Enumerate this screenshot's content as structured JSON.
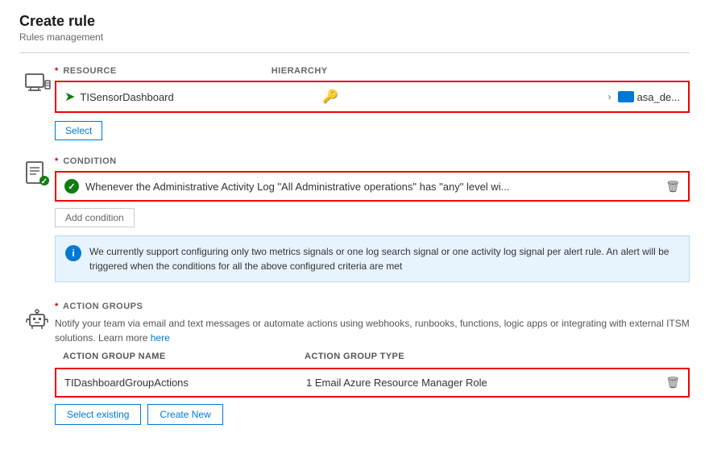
{
  "page": {
    "title": "Create rule",
    "subtitle": "Rules management"
  },
  "resource_section": {
    "label": "RESOURCE",
    "hierarchy_label": "HIERARCHY",
    "resource_name": "TISensorDashboard",
    "hierarchy_asa": "asa_de...",
    "select_button": "Select"
  },
  "condition_section": {
    "label": "CONDITION",
    "condition_text": "Whenever the Administrative Activity Log \"All Administrative operations\" has \"any\" level wi...",
    "add_condition_button": "Add condition",
    "info_text": "We currently support configuring only two metrics signals or one log search signal or one activity log signal per alert rule. An alert will be triggered when the conditions for all the above configured criteria are met"
  },
  "action_groups_section": {
    "label": "ACTION GROUPS",
    "description": "Notify your team via email and text messages or automate actions using webhooks, runbooks, functions, logic apps or integrating with external ITSM solutions. Learn more",
    "learn_more_link": "here",
    "col_name": "ACTION GROUP NAME",
    "col_type": "ACTION GROUP TYPE",
    "action_group_name": "TIDashboardGroupActions",
    "action_group_type": "1 Email Azure Resource Manager Role",
    "select_existing_button": "Select existing",
    "create_new_button": "Create New"
  }
}
